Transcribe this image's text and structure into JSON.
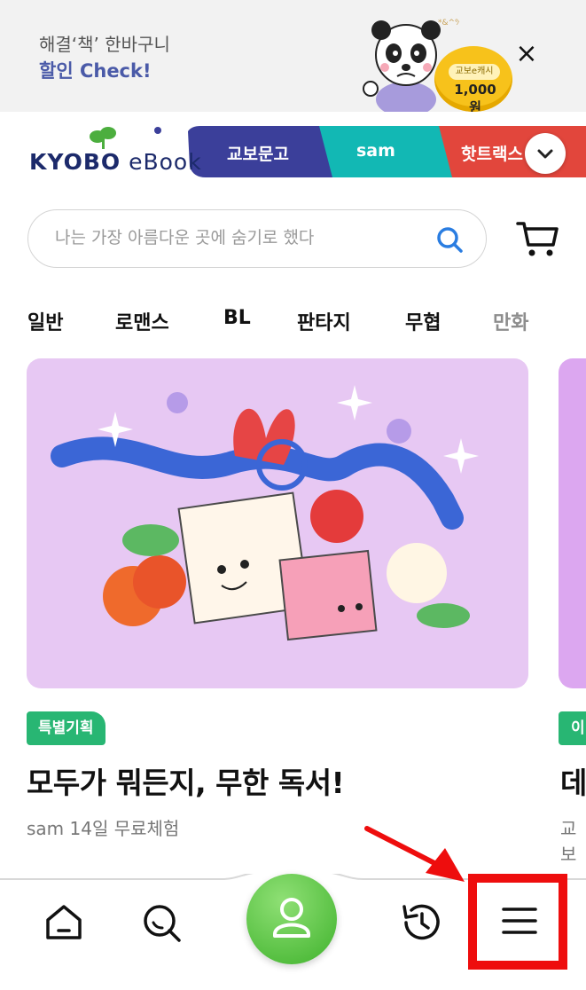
{
  "promo": {
    "line1": "해결‘책’ 한바구니",
    "line2": "할인 Check!",
    "coin_tag": "교보e캐시",
    "coin_amount": "1,000원",
    "close_label": "×"
  },
  "brand": {
    "logo_main": "KYOBO",
    "logo_sub": " eBook"
  },
  "tabs": [
    {
      "label": "교보문고",
      "color": "#3b3f9a"
    },
    {
      "label": "sam",
      "color": "#12b8b4"
    },
    {
      "label": "핫트랙스",
      "color": "#e2463c"
    }
  ],
  "search": {
    "placeholder": "나는 가장 아름다운 곳에 숨기로 했다"
  },
  "categories": [
    "일반",
    "로맨스",
    "BL",
    "판타지",
    "무협",
    "만화"
  ],
  "card": {
    "badge": "특별기획",
    "title": "모두가 뭐든지, 무한 독서!",
    "subtitle": "sam 14일 무료체험"
  },
  "peek_card": {
    "badge": "이",
    "title": "데",
    "subtitle": "교보"
  },
  "colors": {
    "accent_green": "#28b673",
    "highlight_red": "#ee0d0d",
    "logo_navy": "#1c2a6b"
  }
}
